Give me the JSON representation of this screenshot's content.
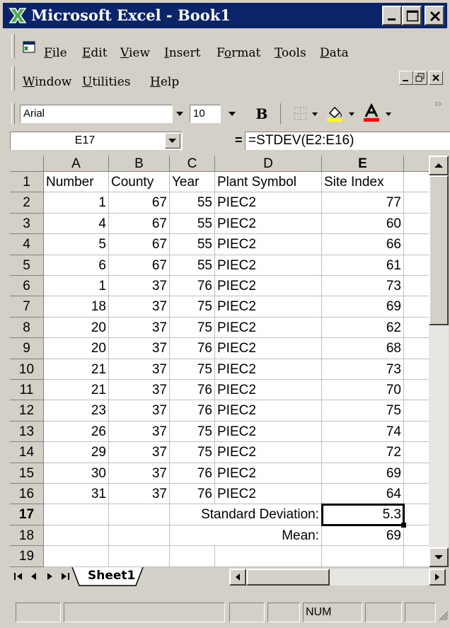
{
  "window": {
    "title": "Microsoft Excel - Book1"
  },
  "menu": {
    "items": [
      "File",
      "Edit",
      "View",
      "Insert",
      "Format",
      "Tools",
      "Data",
      "Window",
      "Utilities",
      "Help"
    ],
    "underlined_chars": [
      "F",
      "E",
      "V",
      "I",
      "o",
      "T",
      "D",
      "W",
      "U",
      "H"
    ]
  },
  "format_toolbar": {
    "font": "Arial",
    "font_size": "10",
    "bold_label": "B",
    "font_color": "#ff0000",
    "fill_color": "#ffff00"
  },
  "formula_bar": {
    "name_box": "E17",
    "equals": "=",
    "formula": "=STDEV(E2:E16)"
  },
  "grid": {
    "columns": [
      "A",
      "B",
      "C",
      "D",
      "E"
    ],
    "row_numbers": [
      "1",
      "2",
      "3",
      "4",
      "5",
      "6",
      "7",
      "8",
      "9",
      "10",
      "11",
      "12",
      "13",
      "14",
      "15",
      "16",
      "17",
      "18",
      "19"
    ],
    "header_row": [
      "Number",
      "County",
      "Year",
      "Plant Symbol",
      "Site Index"
    ],
    "rows": [
      [
        "1",
        "67",
        "55",
        "PIEC2",
        "77"
      ],
      [
        "4",
        "67",
        "55",
        "PIEC2",
        "60"
      ],
      [
        "5",
        "67",
        "55",
        "PIEC2",
        "66"
      ],
      [
        "6",
        "67",
        "55",
        "PIEC2",
        "61"
      ],
      [
        "1",
        "37",
        "76",
        "PIEC2",
        "73"
      ],
      [
        "18",
        "37",
        "75",
        "PIEC2",
        "69"
      ],
      [
        "20",
        "37",
        "75",
        "PIEC2",
        "62"
      ],
      [
        "20",
        "37",
        "76",
        "PIEC2",
        "68"
      ],
      [
        "21",
        "37",
        "75",
        "PIEC2",
        "73"
      ],
      [
        "21",
        "37",
        "76",
        "PIEC2",
        "70"
      ],
      [
        "23",
        "37",
        "76",
        "PIEC2",
        "75"
      ],
      [
        "26",
        "37",
        "75",
        "PIEC2",
        "74"
      ],
      [
        "29",
        "37",
        "75",
        "PIEC2",
        "72"
      ],
      [
        "30",
        "37",
        "76",
        "PIEC2",
        "69"
      ],
      [
        "31",
        "37",
        "76",
        "PIEC2",
        "64"
      ]
    ],
    "stdev_label": "Standard Deviation:",
    "stdev_value": "5.3",
    "mean_label": "Mean:",
    "mean_value": "69",
    "active_cell": "E17"
  },
  "sheet_tabs": {
    "tabs": [
      "Sheet1"
    ]
  },
  "status_bar": {
    "num_indicator": "NUM"
  },
  "icons": [
    "excel-logo-icon",
    "minimize-icon",
    "maximize-icon",
    "close-icon",
    "workbook-icon",
    "borders-icon",
    "fill-color-icon",
    "font-color-icon",
    "dropdown-arrow-icon",
    "scroll-up-icon",
    "scroll-down-icon",
    "scroll-left-icon",
    "scroll-right-icon",
    "first-sheet-icon",
    "prev-sheet-icon",
    "next-sheet-icon",
    "last-sheet-icon",
    "resize-grip-icon"
  ]
}
